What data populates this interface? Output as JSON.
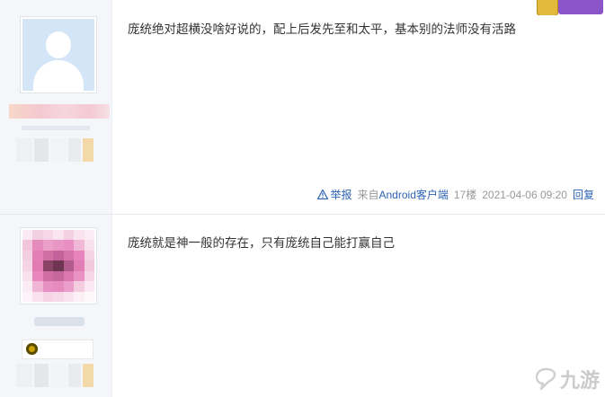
{
  "posts": [
    {
      "text": "庞统绝对超横没啥好说的，配上后发先至和太平，基本别的法师没有活路",
      "meta": {
        "report_label": "举报",
        "source_prefix": "来自",
        "source_link": "Android客户端",
        "floor": "17楼",
        "datetime": "2021-04-06 09:20",
        "reply_label": "回复"
      }
    },
    {
      "text": "庞统就是神一般的存在，只有庞统自己能打赢自己"
    }
  ],
  "watermark": {
    "text": "九游"
  },
  "colors": {
    "link": "#2d64b3",
    "meta_gray": "#999999",
    "side_bg": "#f4f6fa"
  },
  "icons": {
    "report": "warning-triangle-icon",
    "watermark": "jiuyou-logo-icon"
  }
}
